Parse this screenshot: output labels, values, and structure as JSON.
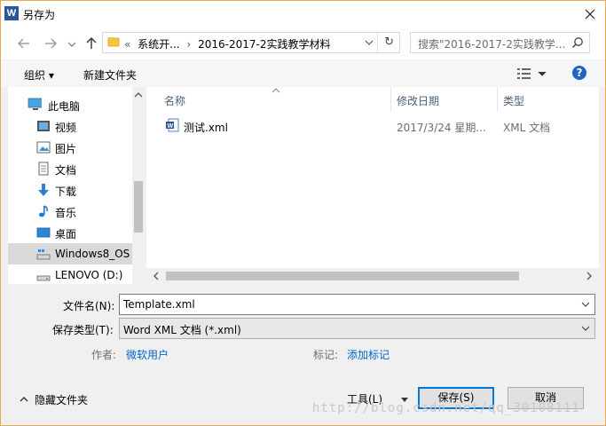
{
  "window": {
    "app_icon": "W",
    "title": "另存为"
  },
  "address": {
    "overflow": "«",
    "crumbs": [
      "系统开...",
      "2016-2017-2实践教学材料"
    ]
  },
  "search": {
    "placeholder": "搜索\"2016-2017-2实践教学..."
  },
  "toolbar": {
    "organize": "组织 ▾",
    "new_folder": "新建文件夹",
    "help": "?"
  },
  "nav_items": [
    {
      "label": "此电脑",
      "icon": "computer-icon"
    },
    {
      "label": "视频",
      "icon": "video-icon"
    },
    {
      "label": "图片",
      "icon": "picture-icon"
    },
    {
      "label": "文档",
      "icon": "document-icon"
    },
    {
      "label": "下载",
      "icon": "download-icon"
    },
    {
      "label": "音乐",
      "icon": "music-icon"
    },
    {
      "label": "桌面",
      "icon": "desktop-icon"
    },
    {
      "label": "Windows8_OS",
      "icon": "drive-icon",
      "selected": true
    },
    {
      "label": "LENOVO (D:)",
      "icon": "drive-icon"
    }
  ],
  "columns": {
    "name": "名称",
    "modified": "修改日期",
    "type": "类型"
  },
  "files": [
    {
      "name": "测试.xml",
      "modified": "2017/3/24 星期...",
      "type": "XML 文档"
    }
  ],
  "form": {
    "filename_label": "文件名(N):",
    "filename_value": "Template.xml",
    "filetype_label": "保存类型(T):",
    "filetype_value": "Word XML 文档 (*.xml)",
    "author_label": "作者:",
    "author_value": "微软用户",
    "tags_label": "标记:",
    "tags_value": "添加标记"
  },
  "footer": {
    "hide_folders": "隐藏文件夹",
    "tools": "工具(L)",
    "save": "保存(S)",
    "cancel": "取消"
  },
  "watermark": "http://blog.csdn.net/qq_30108111",
  "colors": {
    "accent": "#0078d7",
    "link": "#0066cc",
    "window_border": "#e8a94f"
  }
}
